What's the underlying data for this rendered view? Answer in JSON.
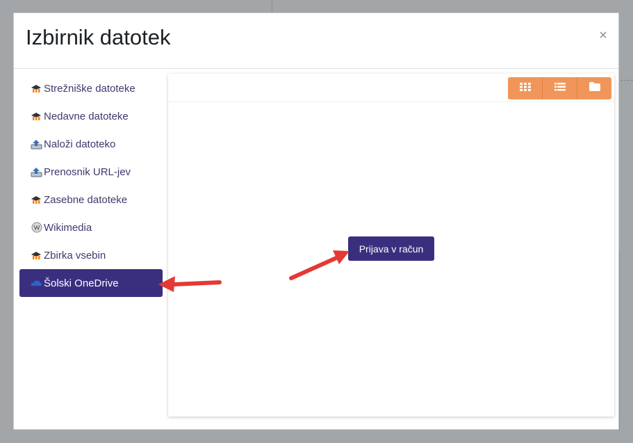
{
  "dialog": {
    "title": "Izbirnik datotek",
    "close_glyph": "×"
  },
  "sidebar": {
    "items": [
      {
        "label": "Strežniške datoteke",
        "icon": "moodle-icon"
      },
      {
        "label": "Nedavne datoteke",
        "icon": "moodle-icon"
      },
      {
        "label": "Naloži datoteko",
        "icon": "upload-icon"
      },
      {
        "label": "Prenosnik URL-jev",
        "icon": "upload-icon"
      },
      {
        "label": "Zasebne datoteke",
        "icon": "moodle-icon"
      },
      {
        "label": "Wikimedia",
        "icon": "wikimedia-icon"
      },
      {
        "label": "Zbirka vsebin",
        "icon": "moodle-icon"
      },
      {
        "label": "Šolski OneDrive",
        "icon": "onedrive-icon",
        "active": true
      }
    ]
  },
  "toolbar": {
    "views": [
      "grid-view-icon",
      "list-view-icon",
      "folder-view-icon"
    ]
  },
  "content": {
    "login_label": "Prijava v račun"
  },
  "colors": {
    "accent_primary": "#3a2f7e",
    "view_buttons": "#f0965a",
    "annotation_arrow": "#e53935"
  }
}
